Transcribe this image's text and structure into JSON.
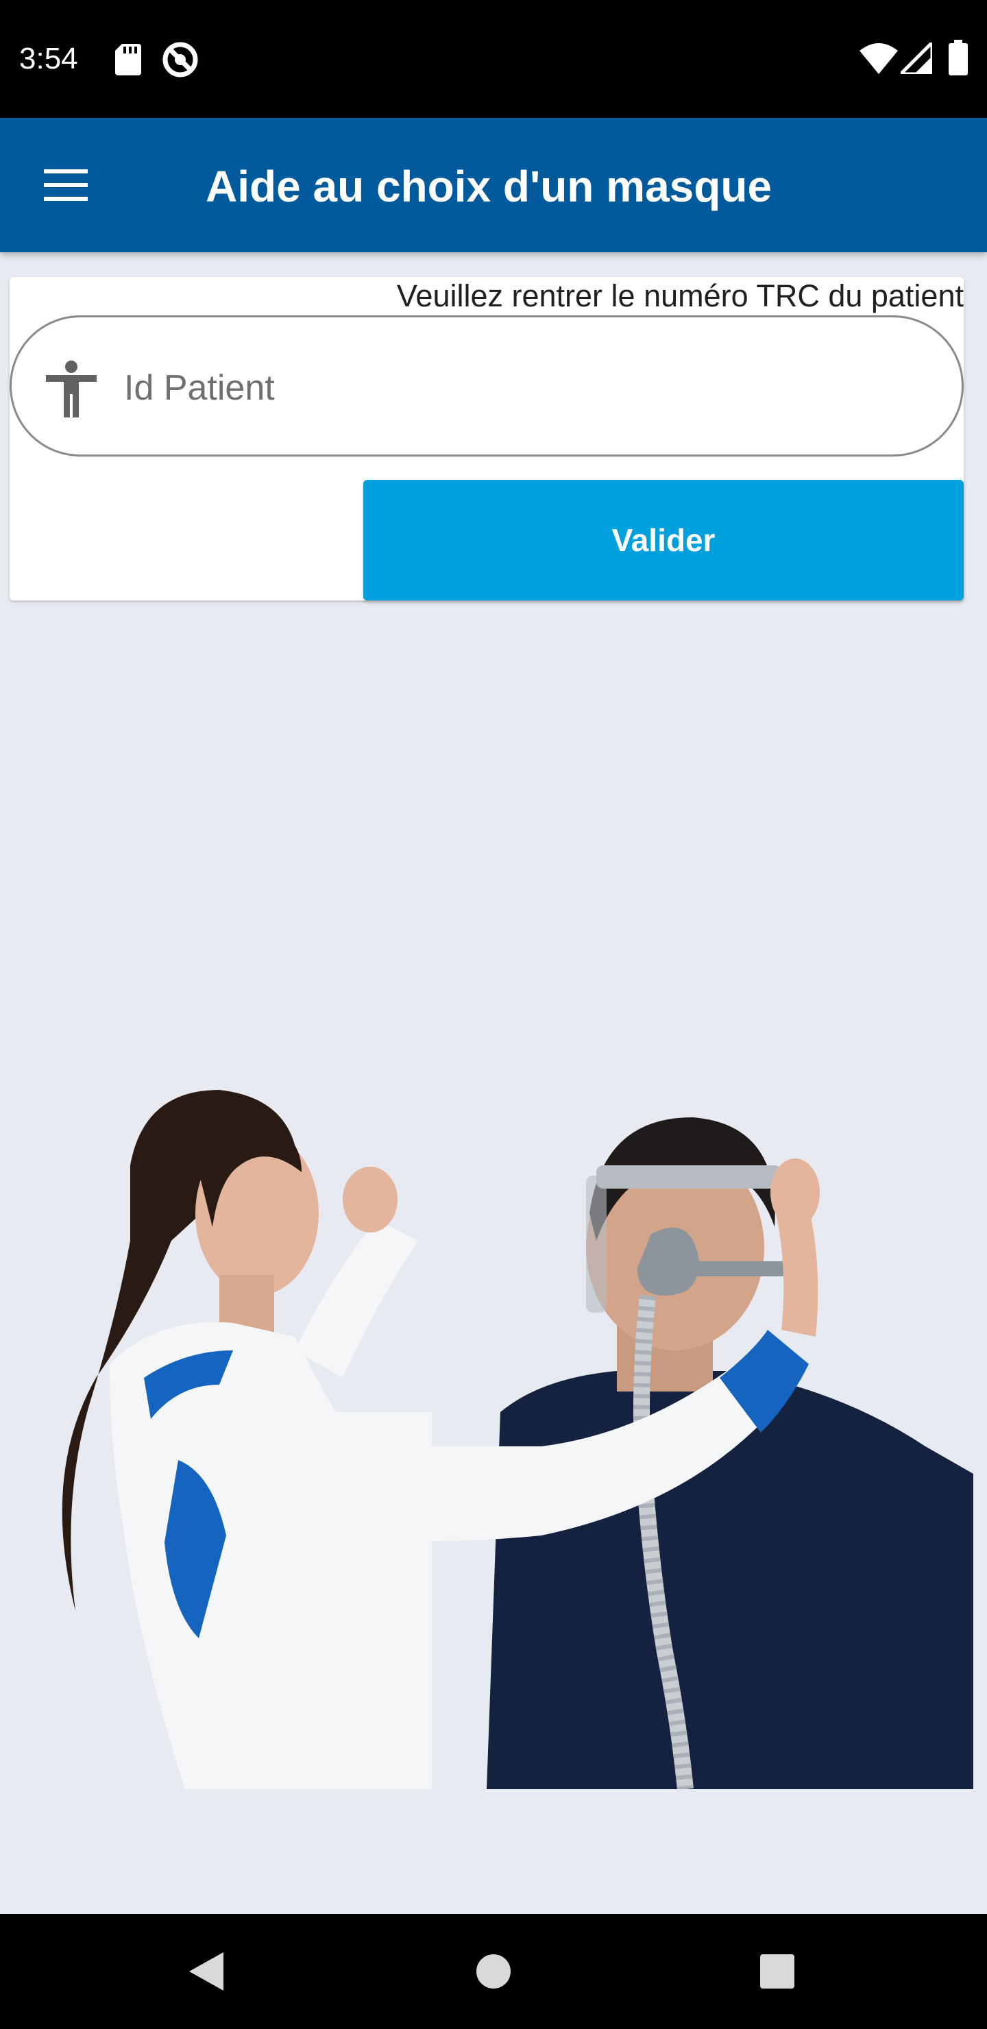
{
  "status_bar": {
    "time": "3:54",
    "left_icons": [
      "sd-card-icon",
      "do-not-disturb-icon"
    ],
    "right_icons": [
      "wifi-icon",
      "cellular-signal-icon",
      "battery-icon"
    ]
  },
  "app_bar": {
    "title": "Aide au choix d'un masque",
    "menu_icon": "hamburger-menu-icon",
    "background": "#005a9b"
  },
  "form": {
    "hint": "Veuillez rentrer le numéro TRC du patient",
    "patient_id": {
      "placeholder": "Id Patient",
      "value": "",
      "icon": "accessibility-person-icon"
    },
    "submit_label": "Valider",
    "submit_color": "#00a0dc"
  },
  "illustration": {
    "subject": "clinician fitting a nasal CPAP mask on a patient"
  },
  "nav_bar": {
    "buttons": [
      "back-icon",
      "home-icon",
      "recents-icon"
    ]
  }
}
